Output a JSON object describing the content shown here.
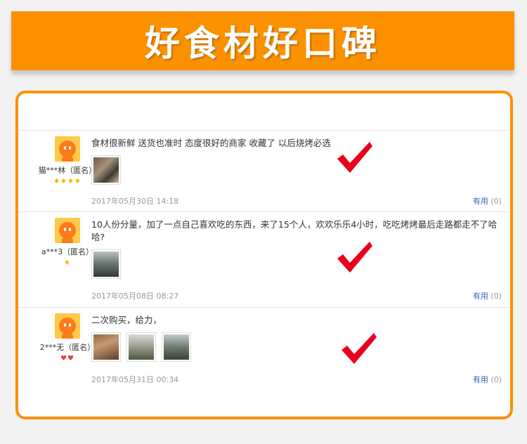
{
  "banner": {
    "title": "好食材好口碑"
  },
  "reviews": [
    {
      "user": "猫***林（匿名）",
      "badges": "♦♦♦♦",
      "text": "食材很新鲜 送货也准时 态度很好的商家 收藏了 以后烧烤必选",
      "date": "2017年05月30日 14:18",
      "useful_label": "有用",
      "useful_count": "(0)"
    },
    {
      "user": "a***3（匿名）",
      "badges": "♦",
      "text": "10人份分量，加了一点自己喜欢吃的东西，来了15个人，欢欢乐乐4小时，吃吃烤烤最后走路都走不了哈哈?",
      "date": "2017年05月08日 08:27",
      "useful_label": "有用",
      "useful_count": "(0)"
    },
    {
      "user": "2***无（匿名）",
      "badges": "♥♥",
      "text": "二次购买，给力，",
      "date": "2017年05月31日 00:34",
      "useful_label": "有用",
      "useful_count": "(0)"
    }
  ],
  "colors": {
    "accent": "#fc9100",
    "link": "#2e65c7",
    "check": "#e8001c"
  }
}
